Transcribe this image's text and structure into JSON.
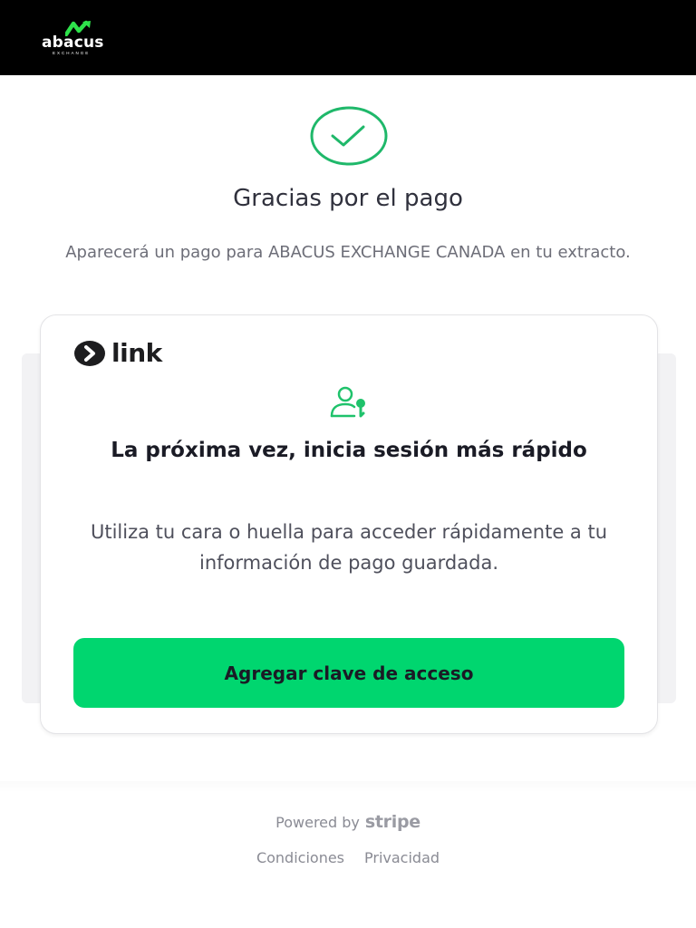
{
  "header": {
    "brand_name": "abacus",
    "brand_sub": "EXCHANGE",
    "brand_icon": "abacus-logo-icon",
    "brand_color": "#2ee24b"
  },
  "confirmation": {
    "icon": "checkmark-icon",
    "title": "Gracias por el pago",
    "message": "Aparecerá un pago para ABACUS EXCHANGE CANADA en tu extracto.",
    "accent_color": "#1fb86a"
  },
  "link_card": {
    "logo_text": "link",
    "icon": "person-key-icon",
    "title": "La próxima vez, inicia sesión más rápido",
    "body": "Utiliza tu cara o huella para acceder rápidamente a tu información de pago guardada.",
    "button_label": "Agregar clave de acceso",
    "button_color": "#00d66f"
  },
  "footer": {
    "powered_by": "Powered by",
    "powered_brand": "stripe",
    "links": [
      "Condiciones",
      "Privacidad"
    ]
  }
}
